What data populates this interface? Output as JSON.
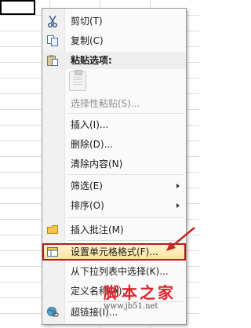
{
  "menu": {
    "items": [
      {
        "id": "cut",
        "label": "剪切(T)",
        "icon": "scissors-icon",
        "enabled": true
      },
      {
        "id": "copy",
        "label": "复制(C)",
        "icon": "copy-icon",
        "enabled": true
      },
      {
        "id": "paste-options",
        "label": "粘贴选项:",
        "icon": "paste-icon",
        "header": true
      },
      {
        "id": "paste-special",
        "label": "选择性粘贴(S)...",
        "enabled": false
      },
      {
        "id": "insert",
        "label": "插入(I)...",
        "enabled": true
      },
      {
        "id": "delete",
        "label": "删除(D)...",
        "enabled": true
      },
      {
        "id": "clear-contents",
        "label": "清除内容(N)",
        "enabled": true
      },
      {
        "id": "filter",
        "label": "筛选(E)",
        "submenu": true
      },
      {
        "id": "sort",
        "label": "排序(O)",
        "submenu": true
      },
      {
        "id": "insert-comment",
        "label": "插入批注(M)",
        "icon": "comment-icon"
      },
      {
        "id": "format-cells",
        "label": "设置单元格格式(F)...",
        "icon": "format-cells-icon",
        "highlighted": true
      },
      {
        "id": "pick-from-list",
        "label": "从下拉列表中选择(K)..."
      },
      {
        "id": "define-name",
        "label": "定义名称(A)..."
      },
      {
        "id": "hyperlink",
        "label": "超链接(I)...",
        "icon": "hyperlink-icon"
      }
    ]
  },
  "watermark": {
    "text": "脚本之家",
    "url": "www.jb51.net"
  },
  "colors": {
    "highlight_border": "#b21c1c",
    "annotation_arrow": "#c62828",
    "watermark": "#d9272e"
  }
}
